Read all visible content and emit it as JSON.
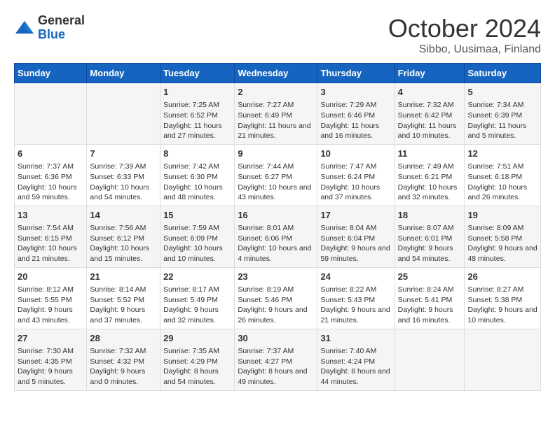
{
  "header": {
    "logo_general": "General",
    "logo_blue": "Blue",
    "title": "October 2024",
    "subtitle": "Sibbo, Uusimaa, Finland"
  },
  "days_of_week": [
    "Sunday",
    "Monday",
    "Tuesday",
    "Wednesday",
    "Thursday",
    "Friday",
    "Saturday"
  ],
  "weeks": [
    [
      {
        "day": "",
        "info": ""
      },
      {
        "day": "",
        "info": ""
      },
      {
        "day": "1",
        "info": "Sunrise: 7:25 AM\nSunset: 6:52 PM\nDaylight: 11 hours and 27 minutes."
      },
      {
        "day": "2",
        "info": "Sunrise: 7:27 AM\nSunset: 6:49 PM\nDaylight: 11 hours and 21 minutes."
      },
      {
        "day": "3",
        "info": "Sunrise: 7:29 AM\nSunset: 6:46 PM\nDaylight: 11 hours and 16 minutes."
      },
      {
        "day": "4",
        "info": "Sunrise: 7:32 AM\nSunset: 6:42 PM\nDaylight: 11 hours and 10 minutes."
      },
      {
        "day": "5",
        "info": "Sunrise: 7:34 AM\nSunset: 6:39 PM\nDaylight: 11 hours and 5 minutes."
      }
    ],
    [
      {
        "day": "6",
        "info": "Sunrise: 7:37 AM\nSunset: 6:36 PM\nDaylight: 10 hours and 59 minutes."
      },
      {
        "day": "7",
        "info": "Sunrise: 7:39 AM\nSunset: 6:33 PM\nDaylight: 10 hours and 54 minutes."
      },
      {
        "day": "8",
        "info": "Sunrise: 7:42 AM\nSunset: 6:30 PM\nDaylight: 10 hours and 48 minutes."
      },
      {
        "day": "9",
        "info": "Sunrise: 7:44 AM\nSunset: 6:27 PM\nDaylight: 10 hours and 43 minutes."
      },
      {
        "day": "10",
        "info": "Sunrise: 7:47 AM\nSunset: 6:24 PM\nDaylight: 10 hours and 37 minutes."
      },
      {
        "day": "11",
        "info": "Sunrise: 7:49 AM\nSunset: 6:21 PM\nDaylight: 10 hours and 32 minutes."
      },
      {
        "day": "12",
        "info": "Sunrise: 7:51 AM\nSunset: 6:18 PM\nDaylight: 10 hours and 26 minutes."
      }
    ],
    [
      {
        "day": "13",
        "info": "Sunrise: 7:54 AM\nSunset: 6:15 PM\nDaylight: 10 hours and 21 minutes."
      },
      {
        "day": "14",
        "info": "Sunrise: 7:56 AM\nSunset: 6:12 PM\nDaylight: 10 hours and 15 minutes."
      },
      {
        "day": "15",
        "info": "Sunrise: 7:59 AM\nSunset: 6:09 PM\nDaylight: 10 hours and 10 minutes."
      },
      {
        "day": "16",
        "info": "Sunrise: 8:01 AM\nSunset: 6:06 PM\nDaylight: 10 hours and 4 minutes."
      },
      {
        "day": "17",
        "info": "Sunrise: 8:04 AM\nSunset: 6:04 PM\nDaylight: 9 hours and 59 minutes."
      },
      {
        "day": "18",
        "info": "Sunrise: 8:07 AM\nSunset: 6:01 PM\nDaylight: 9 hours and 54 minutes."
      },
      {
        "day": "19",
        "info": "Sunrise: 8:09 AM\nSunset: 5:58 PM\nDaylight: 9 hours and 48 minutes."
      }
    ],
    [
      {
        "day": "20",
        "info": "Sunrise: 8:12 AM\nSunset: 5:55 PM\nDaylight: 9 hours and 43 minutes."
      },
      {
        "day": "21",
        "info": "Sunrise: 8:14 AM\nSunset: 5:52 PM\nDaylight: 9 hours and 37 minutes."
      },
      {
        "day": "22",
        "info": "Sunrise: 8:17 AM\nSunset: 5:49 PM\nDaylight: 9 hours and 32 minutes."
      },
      {
        "day": "23",
        "info": "Sunrise: 8:19 AM\nSunset: 5:46 PM\nDaylight: 9 hours and 26 minutes."
      },
      {
        "day": "24",
        "info": "Sunrise: 8:22 AM\nSunset: 5:43 PM\nDaylight: 9 hours and 21 minutes."
      },
      {
        "day": "25",
        "info": "Sunrise: 8:24 AM\nSunset: 5:41 PM\nDaylight: 9 hours and 16 minutes."
      },
      {
        "day": "26",
        "info": "Sunrise: 8:27 AM\nSunset: 5:38 PM\nDaylight: 9 hours and 10 minutes."
      }
    ],
    [
      {
        "day": "27",
        "info": "Sunrise: 7:30 AM\nSunset: 4:35 PM\nDaylight: 9 hours and 5 minutes."
      },
      {
        "day": "28",
        "info": "Sunrise: 7:32 AM\nSunset: 4:32 PM\nDaylight: 9 hours and 0 minutes."
      },
      {
        "day": "29",
        "info": "Sunrise: 7:35 AM\nSunset: 4:29 PM\nDaylight: 8 hours and 54 minutes."
      },
      {
        "day": "30",
        "info": "Sunrise: 7:37 AM\nSunset: 4:27 PM\nDaylight: 8 hours and 49 minutes."
      },
      {
        "day": "31",
        "info": "Sunrise: 7:40 AM\nSunset: 4:24 PM\nDaylight: 8 hours and 44 minutes."
      },
      {
        "day": "",
        "info": ""
      },
      {
        "day": "",
        "info": ""
      }
    ]
  ]
}
